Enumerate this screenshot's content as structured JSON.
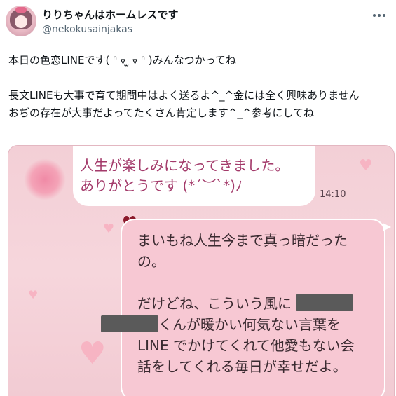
{
  "author": {
    "display_name": "りりちゃんはホームレスです",
    "handle": "@nekokusainjakas"
  },
  "tweet": {
    "line1": "本日の色恋LINEです( ᐢ ᢦ ̫ ᢦ ᐢ )みんなつかってね",
    "line2": "長文LINEも大事で育て期間中はよく送るよ^_^金には全く興味ありません",
    "line3": "おぢの存在が大事だよってたくさん肯定します^_^参考にしてね"
  },
  "chat": {
    "left_line1": "人生が楽しみになってきました。",
    "left_line2": "ありがとうです (*´︶`*)ﾉ",
    "time": "14:10",
    "right_line1": "まいもね人生今まで真っ暗だった",
    "right_line2": "の。",
    "right_line3": "だけどね、こういう風に",
    "right_line4": "くんが暖かい何気ない言葉を",
    "right_line5": "LINE でかけてくれて他愛もない会",
    "right_line6": "話をしてくれる毎日が幸せだよ。"
  },
  "icons": [
    "more-icon",
    "heart-icon",
    "ribbon-icon"
  ],
  "colors": {
    "accent_pink": "#f7c8d3",
    "text_magenta": "#a33a6a"
  }
}
